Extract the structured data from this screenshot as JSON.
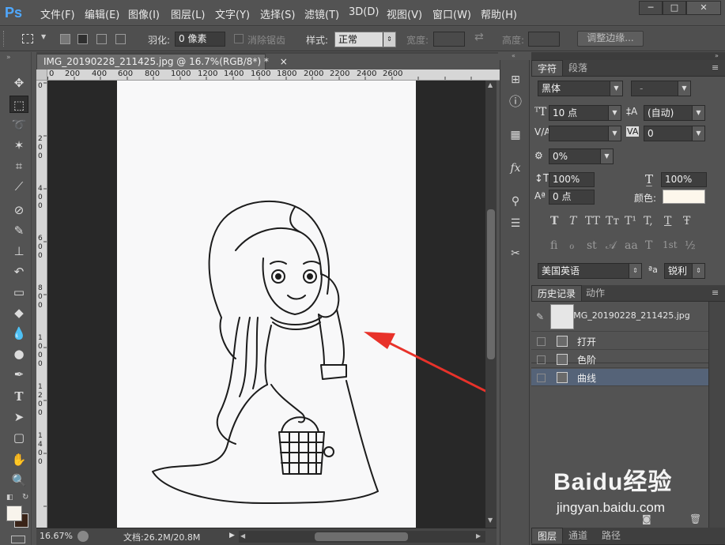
{
  "app": {
    "logo": "Ps"
  },
  "menu": [
    "文件(F)",
    "编辑(E)",
    "图像(I)",
    "图层(L)",
    "文字(Y)",
    "选择(S)",
    "滤镜(T)",
    "3D(D)",
    "视图(V)",
    "窗口(W)",
    "帮助(H)"
  ],
  "window_controls": {
    "minimize": "─",
    "maximize": "□",
    "close": "✕"
  },
  "options": {
    "feather_label": "羽化:",
    "feather_value": "0 像素",
    "antialias_label": "消除锯齿",
    "style_label": "样式:",
    "style_value": "正常",
    "width_label": "宽度:",
    "height_label": "高度:",
    "refine_edge": "调整边缘..."
  },
  "document": {
    "tab_title": "IMG_20190228_211425.jpg @ 16.7%(RGB/8*) *",
    "tab_close": "×",
    "ruler_top": [
      "0",
      "200",
      "400",
      "600",
      "800",
      "1000",
      "1200",
      "1400",
      "1600",
      "1800",
      "2000",
      "2200",
      "2400",
      "2600"
    ],
    "ruler_left": [
      "0",
      "2",
      "0",
      "0",
      "4",
      "0",
      "0",
      "6",
      "0",
      "0",
      "8",
      "0",
      "0",
      "1",
      "0",
      "0",
      "0",
      "1",
      "2",
      "0",
      "0",
      "1",
      "4",
      "0",
      "0"
    ],
    "zoom": "16.67%",
    "doc_size": "文档:26.2M/20.8M"
  },
  "character_panel": {
    "tabs": [
      "字符",
      "段落"
    ],
    "font_family": "黑体",
    "font_style": "-",
    "font_size": "10 点",
    "leading": "(自动)",
    "kerning": "",
    "tracking": "0",
    "scale_percent": "0%",
    "vertical_scale": "100%",
    "horizontal_scale": "100%",
    "baseline_shift": "0 点",
    "color_label": "颜色:",
    "color_value": "#fdf7ec",
    "type_styles": [
      "T",
      "T",
      "TT",
      "Tт",
      "T¹",
      "T,",
      "T",
      "Ŧ"
    ],
    "opentype": [
      "fi",
      "ℴ",
      "st",
      "𝒜",
      "aa",
      "T",
      "1st",
      "½"
    ],
    "language": "美国英语",
    "aa_symbol": "ªa",
    "antialias": "锐利"
  },
  "history_panel": {
    "tabs": [
      "历史记录",
      "动作"
    ],
    "snapshot_name": "IMG_20190228_211425.jpg",
    "steps": [
      "打开",
      "色阶",
      "曲线"
    ],
    "selected_step": 2
  },
  "bottom_tabs": [
    "图层",
    "通道",
    "路径"
  ],
  "watermark": {
    "text": "Baidu经验",
    "url": "jingyan.baidu.com"
  },
  "colors": {
    "arrow": "#e8322a",
    "accent_selection": "#556378",
    "ps_blue": "#4fa8ff"
  }
}
